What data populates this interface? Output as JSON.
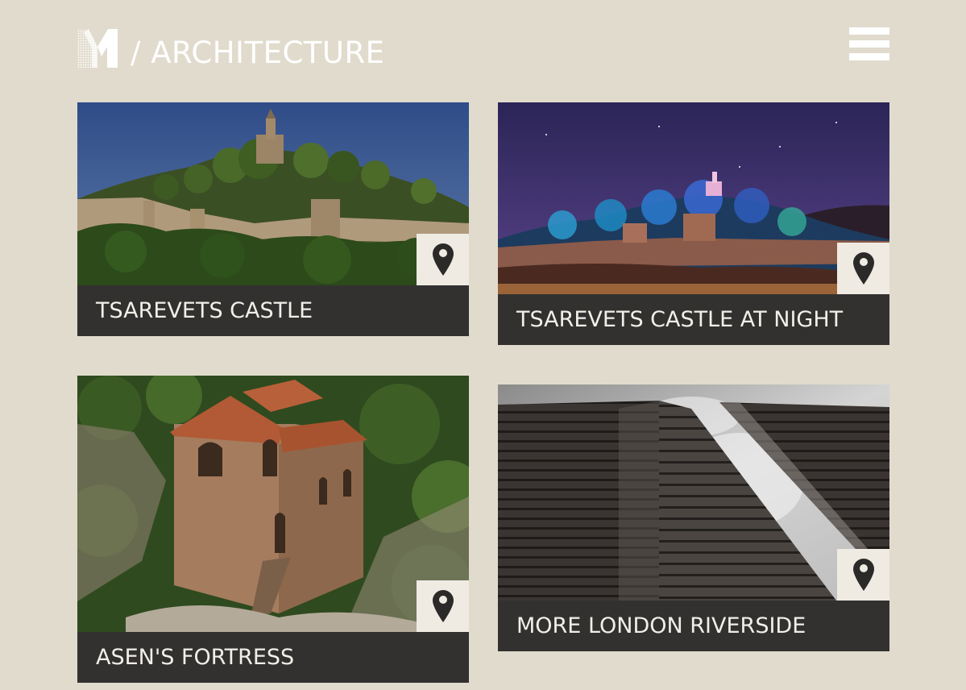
{
  "header": {
    "logo_icon": "m-dotted-logo",
    "section_title": "/ ARCHITECTURE",
    "menu_icon": "hamburger-menu-icon"
  },
  "colors": {
    "background": "#e1dbcd",
    "caption_bg": "#323130",
    "caption_text": "#f2efe9",
    "pin_bg": "#efebe3",
    "pin_icon": "#2b2a29"
  },
  "cards": [
    {
      "title": "TSAREVETS CASTLE",
      "image": "castle-on-hill-day-photo",
      "pin_icon": "map-pin-icon"
    },
    {
      "title": "TSAREVETS CASTLE AT NIGHT",
      "image": "castle-illuminated-night-photo",
      "pin_icon": "map-pin-icon"
    },
    {
      "title": "ASEN'S FORTRESS",
      "image": "stone-church-fortress-photo",
      "pin_icon": "map-pin-icon"
    },
    {
      "title": "MORE LONDON RIVERSIDE",
      "image": "glass-office-buildings-photo",
      "pin_icon": "map-pin-icon"
    }
  ]
}
